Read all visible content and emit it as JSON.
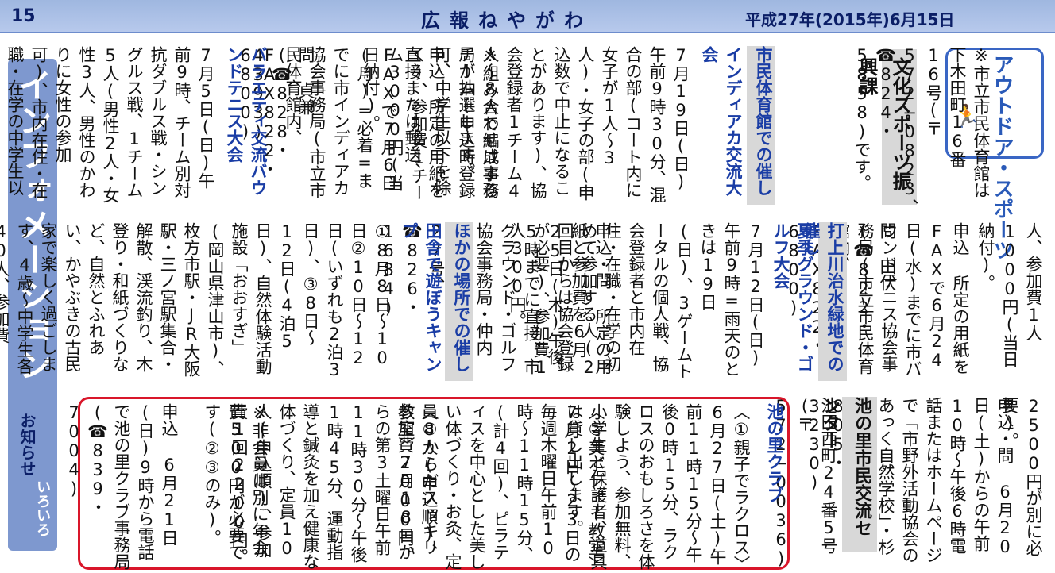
{
  "header": {
    "page_number": "15",
    "masthead": "広報ねやがわ",
    "date": "平成27年(2015年)6月15日"
  },
  "sidebar": {
    "title": "インフォメーション",
    "sub": "お知らせ",
    "sub2": "いろいろ"
  },
  "category": {
    "label": "アウトドア・スポーツ",
    "icon": "runner-icon"
  },
  "section": {
    "title": "文化スポーツ振興課"
  },
  "top_columns": [
    "※市立市民体育館は下木田町16番16号(〒572−0823、☎824・5858)です。",
    "市民体育館での催し",
    "インディアカ交流大会",
    "7月19日(日)午前9時30分、混合の部(コート内に女子が1人〜3人)・女子の部(申込数で中止になることがあります)、協会登録者1チーム4人〜8人で編成するチーム(申込時登録可、中学生以下を除く)、参加費1チーム3000円(当日納付)。",
    "※組み合わせは事務局が抽選します。",
    "申込 所定の用紙を直接または郵送、FAXで7月6日(月)=必着=までに市インディアカ協会事務局(市立市民体育館内、FAX822・6800)",
    "問 貞兼(☎828・4393)",
    "バラエティ交流バウンドテニス大会",
    "7月5日(日)午前9時、チーム別対抗ダブルス戦・シングルス戦、1チーム5人(男性2人・女性3人、男性のかわりに女性の参加可)、市内在住・在職・在学の中学生以上の"
  ],
  "mid_columns": [
    "人、参加費1人1000円(当日納付)。",
    "申込 所定の用紙をFAXで6月24日(水)までに市バウンドテニス協会事務局(市立市民体育館内、FAX822・6800)",
    "問 田伏(☎822・2890)",
    "打上川治水緑地での催し",
    "夏季グラウンド・ゴルフ大会",
    "7月12日(日)午前9時=雨天のときは19日(日)、3ゲームトータルの個人戦、協会登録者と市内在住・在職・在学の初めて参加する人(2回目からは協会登録が必要)、参加費1人300円。",
    "申込・問 所定の用紙と参加費を6月25日(木)午後5時までに直接、市グラウンド・ゴルフ協会事務局・仲内(大利町22番27号、☎826・1684)",
    "ほかの場所での催し",
    "田舎で遊ぼうキャンプ",
    "①8月8日〜10日②10日〜12日(いずれも2泊3日)、③8日〜12日(4泊5日)、自然体験活動施設「おおすぎ」(岡山県津山市)、枚方市駅・JR大阪駅・三ノ宮駅集合・解散、渓流釣り、木登り・和紙づくりなど、自然とふれあい、かやぶきの古民家で楽しく過ごします、4歳〜中学生各40人、参加費①②2万6000円③4万6000円(初めての人は入会金"
  ],
  "bottom_columns": [
    "2500円が別に必要)。",
    "申込・問 6月20日(土)からの午前10時〜午後6時電話またはホームページで「市野外活動協会のあっく自然学校」・杉本(☎072・805・3230)",
    "池の里市民交流センター",
    "池田西町24番5号(〒572−0036)",
    "池の里クラブ",
    "〈①親子でラクロス〉6月27日(土)午前11時15分〜午後0時15分、ラクロスのおもしろさを体験しよう、参加無料、小学生と保護者、道具は貸し出します。",
    "〈②美ボディー教室〉7月2日〜23日の毎週木曜日午前10時〜11時15分、(計4回)、ピラティスを中心とした美しい体づくり・お灸、定員8人(申込順)、参加費2000円。",
    "〈③からだスッキリ教室〉7月18日からの第3土曜日午前11時30分〜午後1時45分、運動指導と鍼灸を加え健康な体づくり、定員10人(申込順)、参加費1回2200円。",
    "※非会員は別に年会費500円が必要です(②③のみ)。",
    "申込 6月21日(日)9時から電話で池の里クラブ事務局(☎839・7004)"
  ]
}
